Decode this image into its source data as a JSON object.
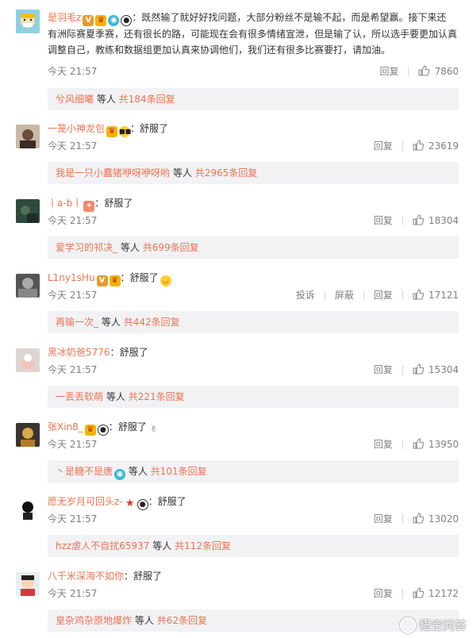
{
  "comments": [
    {
      "username": "是羽毛z",
      "text": "既然输了就好好找问题，大部分粉丝不是输不起，而是希望赢。接下来还有洲际赛夏季赛，还有很长的路，可能现在会有很多情绪宣泄，但是输了认，所以选手要更加认真调整自己，教练和数据组更加认真来协调他们，我们还有很多比赛要打，请加油。",
      "text_lines": [
        "既然输了就好好找问题，大部分粉丝不是输不起，而是希望赢。接下来还",
        "有洲际赛夏季赛，还有很长的路，可能现在会有很多情绪宣泄，但是输了认，所以选手要更加认真",
        "调整自己，教练和数据组更加认真来协调他们，我们还有很多比赛要打，请加油。"
      ],
      "time": "今天 21:57",
      "reply_label": "回复",
      "likes": "7860",
      "reply_user": "兮风细曦",
      "reply_mid": "等人",
      "reply_total": "共184条回复"
    },
    {
      "username": "一笼小神龙包",
      "text": "舒服了",
      "time": "今天 21:57",
      "reply_label": "回复",
      "likes": "23619",
      "reply_user": "我是一只小蠢猪咿呀咿呀哟",
      "reply_mid": "等人",
      "reply_total": "共2965条回复"
    },
    {
      "username": "丨a-b丨",
      "text": "舒服了",
      "time": "今天 21:57",
      "reply_label": "回复",
      "likes": "18304",
      "reply_user": "爱学习的祁决_",
      "reply_mid": "等人",
      "reply_total": "共699条回复"
    },
    {
      "username": "L1ny1sHu",
      "text": "舒服了",
      "time": "今天 21:57",
      "report_label": "投诉",
      "block_label": "屏蔽",
      "reply_label": "回复",
      "likes": "17121",
      "reply_user": "再输一次_",
      "reply_mid": "等人",
      "reply_total": "共442条回复"
    },
    {
      "username": "黑冰奶爸5776",
      "text": "舒服了",
      "time": "今天 21:57",
      "reply_label": "回复",
      "likes": "15304",
      "reply_user": "一丢丢软萌",
      "reply_mid": "等人",
      "reply_total": "共221条回复"
    },
    {
      "username": "张Xin8_",
      "text": "舒服了",
      "time": "今天 21:57",
      "reply_label": "回复",
      "likes": "13950",
      "reply_user": "丶是糖不是唐",
      "reply_mid": "等人",
      "reply_total": "共101条回复"
    },
    {
      "username": "愿无岁月可回头z-",
      "text": "舒服了",
      "time": "今天 21:57",
      "reply_label": "回复",
      "likes": "13020",
      "reply_user": "hzz虐人不自扰65937",
      "reply_mid": "等人",
      "reply_total": "共112条回复"
    },
    {
      "username": "八千米深海不如你",
      "text": "舒服了",
      "time": "今天 21:57",
      "reply_label": "回复",
      "likes": "12172",
      "reply_user": "皇杂鸡杂原地爆炸",
      "reply_mid": "等人",
      "reply_total": "共62条回复"
    }
  ],
  "separator": "：",
  "watermark": "悟空问答",
  "colors": {
    "username": "#eb7350",
    "meta": "#808080",
    "reply_bg": "#f2f2f5"
  },
  "icons": [
    "like-icon",
    "avatar",
    "vip-badge",
    "emoji-badge",
    "panda-badge",
    "watermark-logo-icon"
  ]
}
